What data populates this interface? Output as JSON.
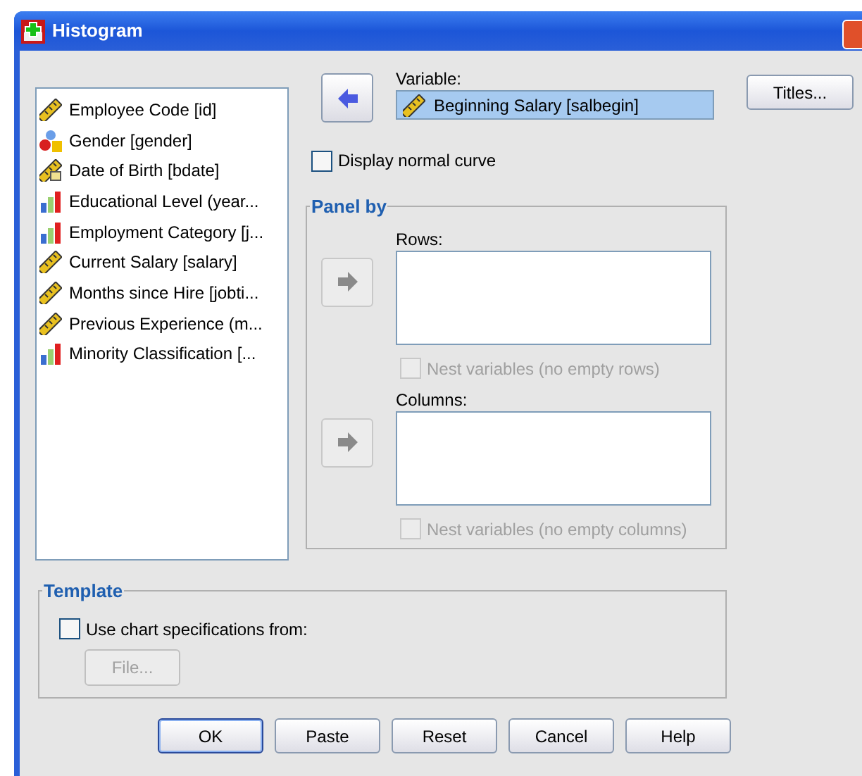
{
  "window": {
    "title": "Histogram"
  },
  "variables": [
    {
      "label": "Employee Code [id]",
      "kind": "scale"
    },
    {
      "label": "Gender [gender]",
      "kind": "nominal"
    },
    {
      "label": "Date of Birth [bdate]",
      "kind": "date"
    },
    {
      "label": "Educational Level (year...",
      "kind": "ordinal"
    },
    {
      "label": "Employment Category [j...",
      "kind": "ordinal"
    },
    {
      "label": "Current Salary [salary]",
      "kind": "scale"
    },
    {
      "label": "Months since Hire [jobti...",
      "kind": "scale"
    },
    {
      "label": "Previous Experience (m...",
      "kind": "scale"
    },
    {
      "label": "Minority Classification [...",
      "kind": "ordinal"
    }
  ],
  "variable": {
    "label": "Variable:",
    "value": "Beginning Salary [salbegin]",
    "kind": "scale",
    "arrow_disabled": false
  },
  "titles_button": "Titles...",
  "display_normal_curve": {
    "label": "Display normal curve",
    "checked": false
  },
  "panel_by": {
    "title": "Panel by",
    "rows": {
      "label": "Rows:",
      "arrow_disabled": true,
      "nest": {
        "label": "Nest variables (no empty rows)",
        "checked": false,
        "disabled": true
      }
    },
    "columns": {
      "label": "Columns:",
      "arrow_disabled": true,
      "nest": {
        "label": "Nest variables (no empty columns)",
        "checked": false,
        "disabled": true
      }
    }
  },
  "template": {
    "title": "Template",
    "use_chart_specs": {
      "label": "Use chart specifications from:",
      "checked": false
    },
    "file_button": {
      "label": "File...",
      "disabled": true
    }
  },
  "buttons": [
    {
      "label": "OK",
      "default": true
    },
    {
      "label": "Paste",
      "default": false
    },
    {
      "label": "Reset",
      "default": false
    },
    {
      "label": "Cancel",
      "default": false
    },
    {
      "label": "Help",
      "default": false
    }
  ]
}
